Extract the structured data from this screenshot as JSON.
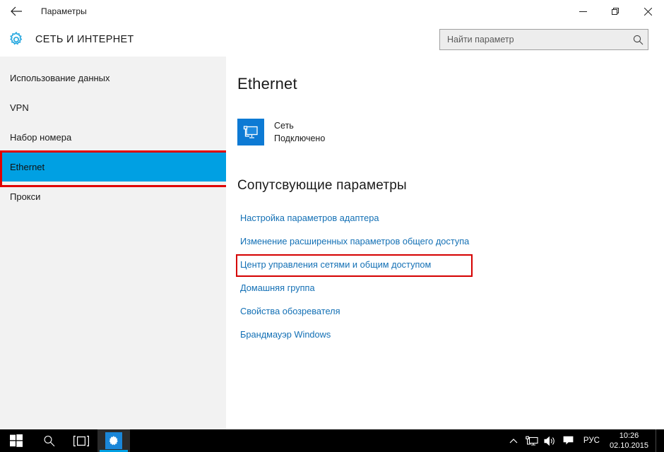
{
  "window": {
    "title": "Параметры",
    "back_icon": "back-arrow-icon",
    "controls": {
      "minimize": "minimize-icon",
      "restore": "restore-icon",
      "close": "close-icon"
    }
  },
  "header": {
    "category_icon": "gear-icon",
    "category_title": "СЕТЬ И ИНТЕРНЕТ",
    "search": {
      "placeholder": "Найти параметр",
      "value": "",
      "icon": "search-icon"
    }
  },
  "sidebar": {
    "items": [
      {
        "label": "Использование данных",
        "selected": false,
        "annotated": false
      },
      {
        "label": "VPN",
        "selected": false,
        "annotated": false
      },
      {
        "label": "Набор номера",
        "selected": false,
        "annotated": false
      },
      {
        "label": "Ethernet",
        "selected": true,
        "annotated": true
      },
      {
        "label": "Прокси",
        "selected": false,
        "annotated": false
      }
    ]
  },
  "main": {
    "page_title": "Ethernet",
    "network": {
      "icon": "ethernet-monitor-icon",
      "name": "Сеть",
      "state": "Подключено"
    },
    "related": {
      "title": "Сопутсвующие параметры",
      "links": [
        {
          "label": "Настройка параметров адаптера",
          "annotated": false
        },
        {
          "label": "Изменение расширенных параметров общего доступа",
          "annotated": false
        },
        {
          "label": "Центр управления сетями и общим доступом",
          "annotated": true
        },
        {
          "label": "Домашняя группа",
          "annotated": false
        },
        {
          "label": "Свойства обозревателя",
          "annotated": false
        },
        {
          "label": "Брандмауэр Windows",
          "annotated": false
        }
      ]
    }
  },
  "taskbar": {
    "start_icon": "windows-start-icon",
    "search_icon": "search-icon",
    "taskview_icon": "task-view-icon",
    "settings_icon": "gear-icon",
    "tray": {
      "chevron_icon": "chevron-up-icon",
      "network_icon": "network-icon",
      "volume_icon": "speaker-icon",
      "action_center_icon": "action-center-icon",
      "language": "РУС",
      "time": "10:26",
      "date": "02.10.2015"
    }
  },
  "colors": {
    "accent_blue": "#00a0e3",
    "link_blue": "#1370b5",
    "annotation_red": "#d50000",
    "sidebar_bg": "#f2f2f2",
    "tile_blue": "#0d7ad4"
  }
}
